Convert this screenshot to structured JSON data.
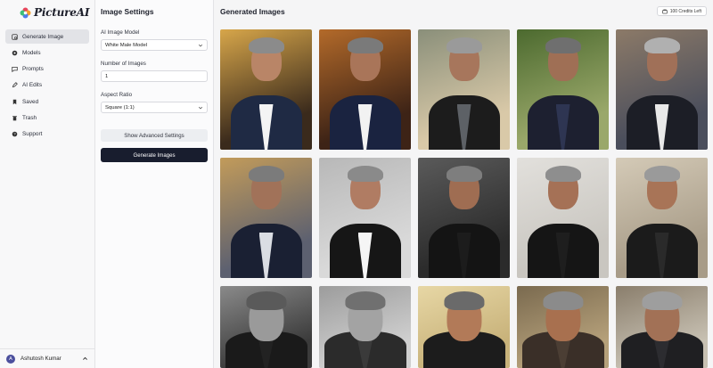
{
  "app": {
    "logo_text": "PictureAI",
    "logo_colors": [
      "#e8465c",
      "#f59e2b",
      "#4f7be8",
      "#3dbf77"
    ]
  },
  "sidebar": {
    "items": [
      {
        "label": "Generate Image",
        "icon": "sparkle-icon",
        "active": true
      },
      {
        "label": "Models",
        "icon": "models-icon",
        "active": false
      },
      {
        "label": "Prompts",
        "icon": "prompts-icon",
        "active": false
      },
      {
        "label": "AI Edits",
        "icon": "edit-icon",
        "active": false
      },
      {
        "label": "Saved",
        "icon": "bookmark-icon",
        "active": false
      },
      {
        "label": "Trash",
        "icon": "trash-icon",
        "active": false
      },
      {
        "label": "Support",
        "icon": "support-icon",
        "active": false
      }
    ],
    "user": {
      "name": "Ashutosh Kumar",
      "initial": "A"
    }
  },
  "settings": {
    "title": "Image Settings",
    "model_label": "AI Image Model",
    "model_value": "White Male Model",
    "count_label": "Number of Images",
    "count_value": "1",
    "ratio_label": "Aspect Ratio",
    "ratio_value": "Square (1:1)",
    "advanced_button": "Show Advanced Settings",
    "generate_button": "Generate Images"
  },
  "main": {
    "title": "Generated Images",
    "credits": "100 Credits Left"
  },
  "images": [
    {
      "bg": "#3a2a1c",
      "bg2": "#d7a64a",
      "suit": "#1f2a44",
      "shirt": "#f4f4f4",
      "skin": "#b98567",
      "hair": "#8b8b8b"
    },
    {
      "bg": "#3d2316",
      "bg2": "#b36a2a",
      "suit": "#1a2340",
      "shirt": "#f2f2f2",
      "skin": "#a97559",
      "hair": "#7a7a7a"
    },
    {
      "bg": "#d9c9a8",
      "bg2": "#8a8f7a",
      "suit": "#1c1c1c",
      "shirt": "#5d6166",
      "skin": "#a7765c",
      "hair": "#9a9a9a"
    },
    {
      "bg": "#9aa86a",
      "bg2": "#4c6a2f",
      "suit": "#1d2030",
      "shirt": "#2e3552",
      "skin": "#9f6f55",
      "hair": "#6f6f6f"
    },
    {
      "bg": "#4a4e5c",
      "bg2": "#8c7a68",
      "suit": "#1c1e26",
      "shirt": "#e9e9e9",
      "skin": "#a07058",
      "hair": "#b0b0b0"
    },
    {
      "bg": "#5c6070",
      "bg2": "#c29b5a",
      "suit": "#1a2033",
      "shirt": "#dadde3",
      "skin": "#a17259",
      "hair": "#7b7b7b"
    },
    {
      "bg": "#d9d9d9",
      "bg2": "#b8b8b8",
      "suit": "#161616",
      "shirt": "#f5f5f5",
      "skin": "#b07c63",
      "hair": "#8a8a8a"
    },
    {
      "bg": "#2b2b2b",
      "bg2": "#5a5a5a",
      "suit": "#141414",
      "shirt": "#1c1c1c",
      "skin": "#9f6d52",
      "hair": "#7e7e7e"
    },
    {
      "bg": "#c9c6c0",
      "bg2": "#e2e0dc",
      "suit": "#151515",
      "shirt": "#1e1e1e",
      "skin": "#a57156",
      "hair": "#8e8e8e"
    },
    {
      "bg": "#a89c88",
      "bg2": "#d4cab7",
      "suit": "#1b1b1b",
      "shirt": "#2a2a2a",
      "skin": "#a87457",
      "hair": "#9a9a9a"
    },
    {
      "bg": "#3b3b3b",
      "bg2": "#8a8a8a",
      "suit": "#1a1a1a",
      "shirt": "#222",
      "skin": "#9a9a9a",
      "hair": "#5a5a5a"
    },
    {
      "bg": "#cfcfcf",
      "bg2": "#9c9c9c",
      "suit": "#2b2b2b",
      "shirt": "#3a3a3a",
      "skin": "#a3a3a3",
      "hair": "#707070"
    },
    {
      "bg": "#c8b27a",
      "bg2": "#e7d7a5",
      "suit": "#1c1c1c",
      "shirt": "#1c1c1c",
      "skin": "#b27a58",
      "hair": "#6a6a6a"
    },
    {
      "bg": "#b5a07a",
      "bg2": "#7a6a4f",
      "suit": "#3a2f28",
      "shirt": "#4b3e34",
      "skin": "#a8704f",
      "hair": "#8b8b8b"
    },
    {
      "bg": "#c7c0b2",
      "bg2": "#8a7e6c",
      "suit": "#1f1f22",
      "shirt": "#2c2c30",
      "skin": "#a27156",
      "hair": "#9e9e9e"
    }
  ]
}
